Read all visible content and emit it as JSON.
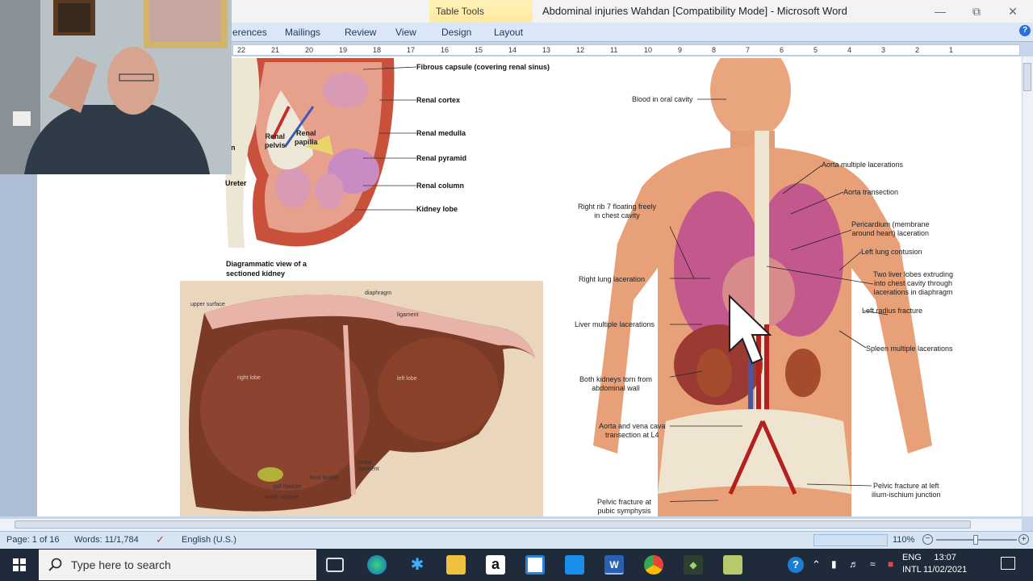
{
  "window": {
    "contextual_tab": "Table Tools",
    "title": "Abdominal injuries Wahdan [Compatibility Mode] - Microsoft Word",
    "minimize_icon": "minimize-icon",
    "restore_icon": "restore-icon",
    "close_icon": "close-icon"
  },
  "ribbon": {
    "tabs": [
      "erences",
      "Mailings",
      "Review",
      "View",
      "Design",
      "Layout"
    ]
  },
  "ruler": {
    "ticks": [
      "22",
      "21",
      "20",
      "19",
      "18",
      "17",
      "16",
      "15",
      "14",
      "13",
      "12",
      "11",
      "10",
      "9",
      "8",
      "7",
      "6",
      "5",
      "4",
      "3",
      "2",
      "1"
    ]
  },
  "kidney_figure": {
    "labels": [
      "Fibrous capsule (covering renal sinus)",
      "Renal cortex",
      "Renal medulla",
      "Renal pyramid",
      "Renal column",
      "Kidney lobe"
    ],
    "inner_pelvis": "Renal\npelvis",
    "inner_papilla": "Renal\npapilla",
    "ureter": "Ureter",
    "n_fragment": "n",
    "caption_line1": "Diagrammatic view of a",
    "caption_line2": "sectioned kidney"
  },
  "liver_figure": {
    "upper_surface": "upper surface",
    "diaphragm": "diaphragm",
    "ligament": "ligament",
    "right_lobe": "right lobe",
    "left_lobe": "left lobe",
    "round_ligament": "round\nligament",
    "front_border": "front border",
    "gall_bladder": "gall bladder",
    "under_surface": "under surface"
  },
  "trauma_figure": {
    "left_labels": [
      "Blood in oral cavity",
      "Right rib 7 floating freely\nin chest cavity",
      "Right lung laceration",
      "Liver multiple lacerations",
      "Both kidneys torn from\nabdominal wall",
      "Aorta and vena cava\ntransection at L4",
      "Pelvic fracture at\npubic symphysis"
    ],
    "right_labels": [
      "Aorta multiple lacerations",
      "Aorta transection",
      "Pericardium (membrane\naround heart) laceration",
      "Left lung contusion",
      "Two liver lobes extruding\ninto chest cavity through\nlacerations in diaphragm",
      "Left radius fracture",
      "Spleen multiple lacerations",
      "Pelvic fracture at left\nilium-ischium junction"
    ]
  },
  "status_bar": {
    "page": "Page: 1 of 16",
    "words": "Words: 11/1,784",
    "language": "English (U.S.)",
    "zoom": "110%"
  },
  "taskbar": {
    "search_placeholder": "Type here to search",
    "lang_line1": "ENG",
    "lang_line2": "INTL",
    "time": "13:07",
    "date": "11/02/2021"
  }
}
